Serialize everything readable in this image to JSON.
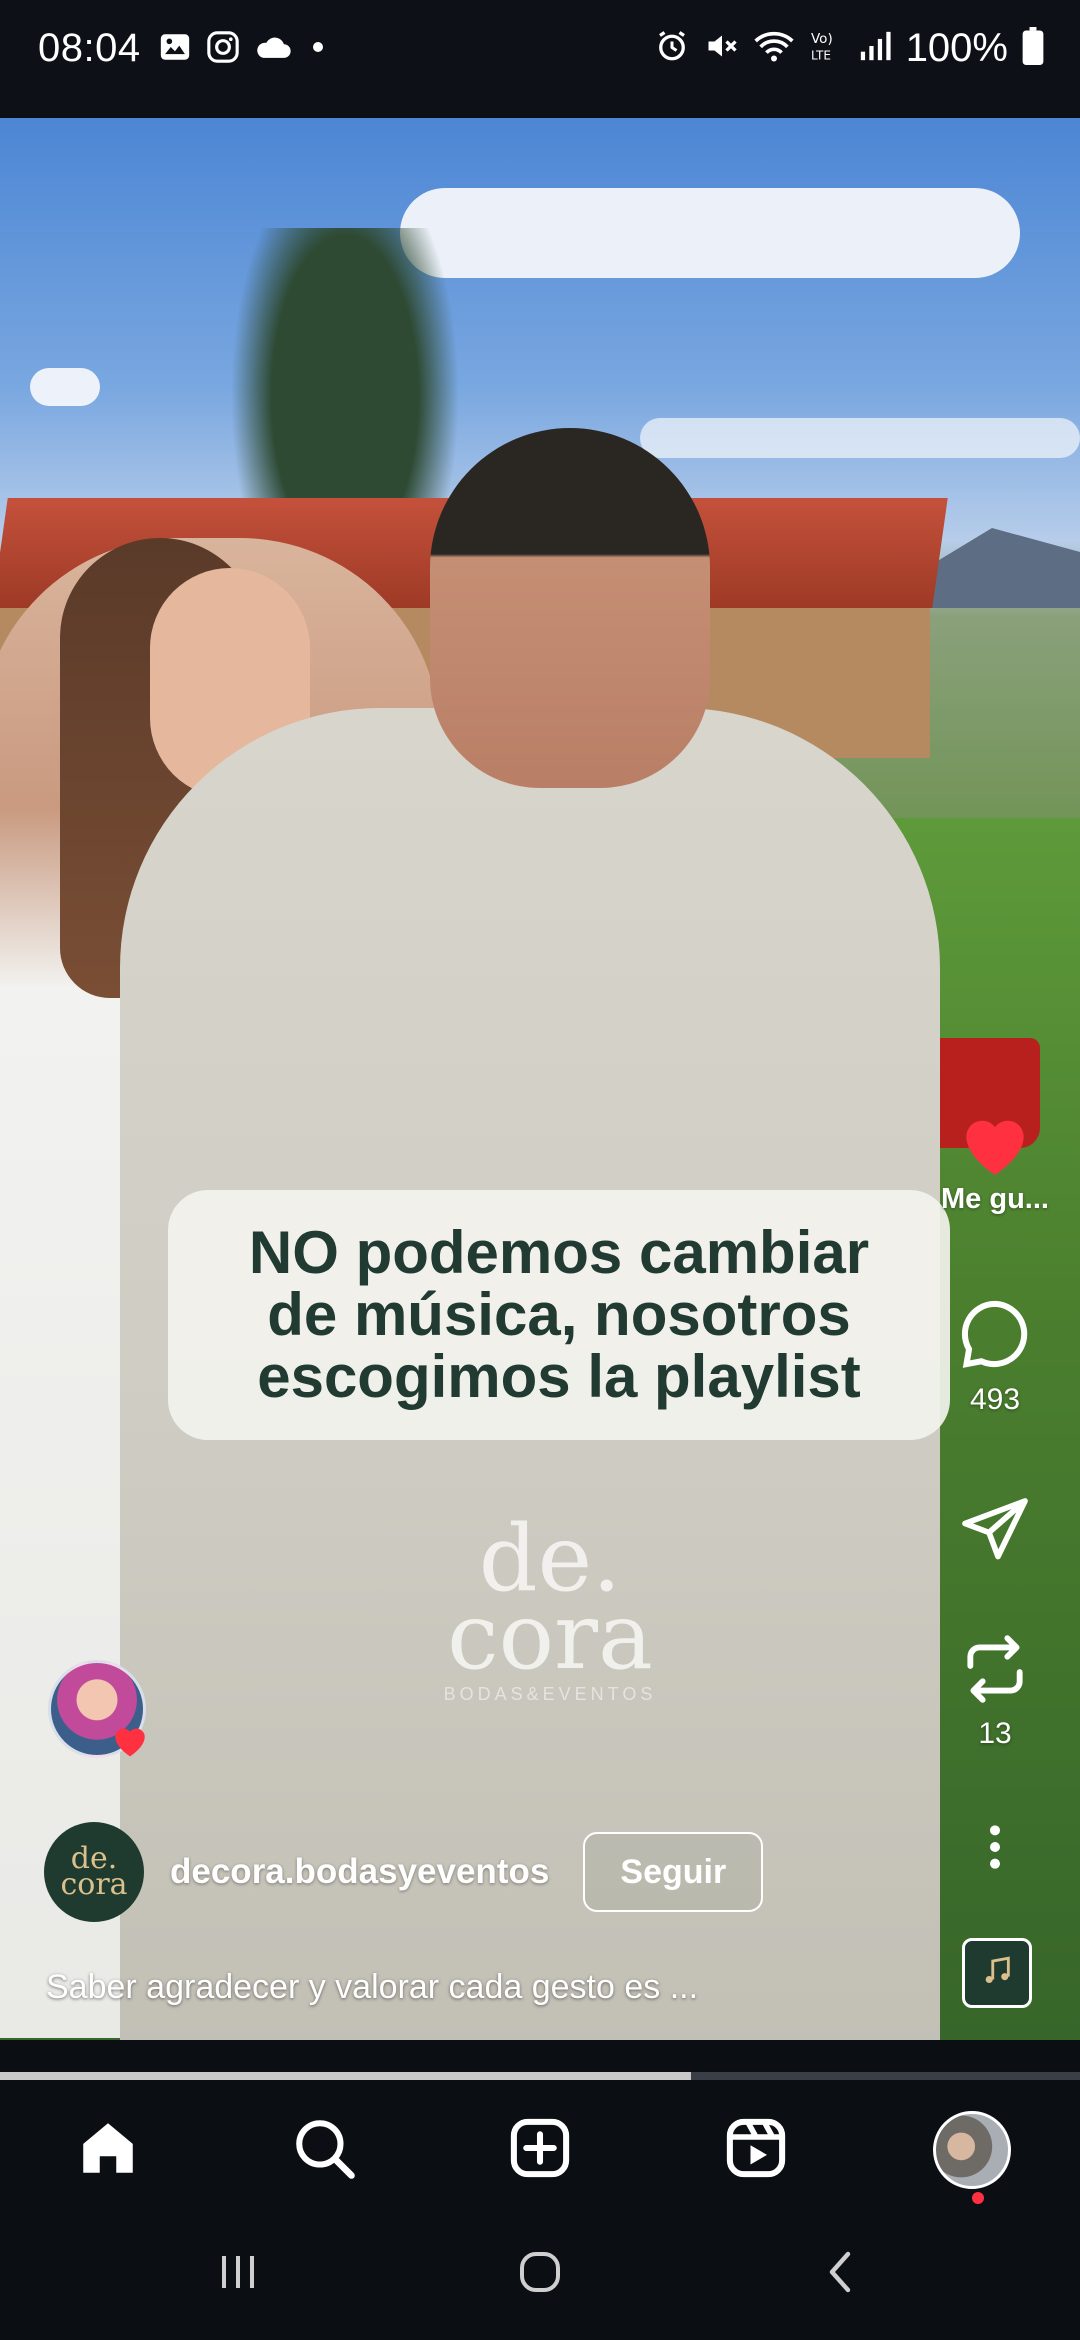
{
  "status_bar": {
    "time": "08:04",
    "battery": "100%",
    "left_icons": [
      "gallery-icon",
      "instagram-icon",
      "cloud-icon",
      "dot-icon"
    ],
    "right_icons": [
      "alarm-icon",
      "mute-icon",
      "wifi-icon",
      "volte-icon",
      "signal-icon",
      "battery-icon"
    ]
  },
  "reel": {
    "caption_overlay": "NO podemos cambiar\nde música, nosotros\nescogimos la playlist",
    "watermark_main": "de.\ncora",
    "watermark_sub": "BODAS&EVENTOS",
    "account_avatar_text": "de.\ncora",
    "account_name": "decora.bodasyeventos",
    "follow_label": "Seguir",
    "description": "Saber agradecer y valorar cada gesto es ...",
    "progress": 0.64
  },
  "actions": {
    "like_label": "Me gu...",
    "comments_count": "493",
    "reposts_count": "13"
  },
  "colors": {
    "like_red": "#ff3040",
    "caption_text": "#213b33",
    "caption_bg": "#f3f3ee"
  },
  "bottom_nav": {
    "items": [
      "home-icon",
      "search-icon",
      "create-icon",
      "reels-icon",
      "profile-avatar"
    ]
  },
  "system_nav": {
    "items": [
      "recents-icon",
      "home-circle-icon",
      "back-icon"
    ]
  }
}
